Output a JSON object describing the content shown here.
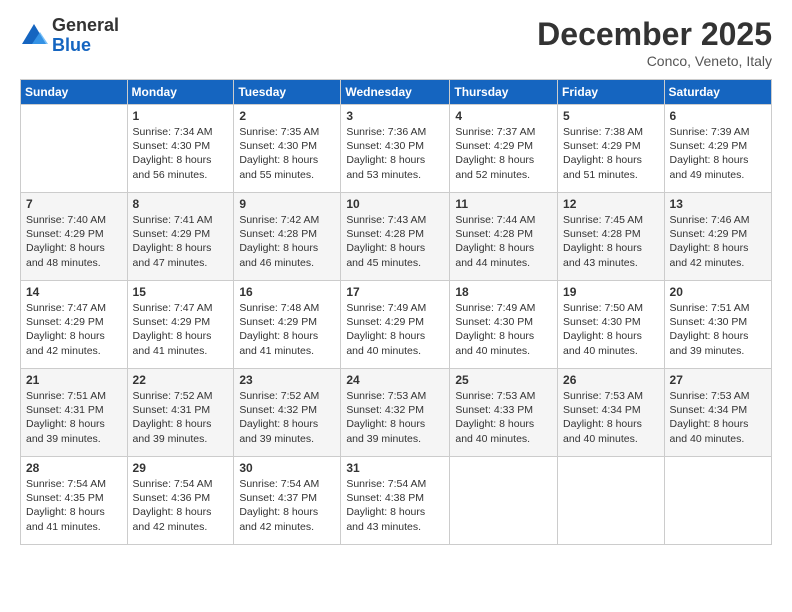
{
  "header": {
    "logo_line1": "General",
    "logo_line2": "Blue",
    "month": "December 2025",
    "location": "Conco, Veneto, Italy"
  },
  "days_of_week": [
    "Sunday",
    "Monday",
    "Tuesday",
    "Wednesday",
    "Thursday",
    "Friday",
    "Saturday"
  ],
  "weeks": [
    [
      {
        "day": "",
        "info": ""
      },
      {
        "day": "1",
        "info": "Sunrise: 7:34 AM\nSunset: 4:30 PM\nDaylight: 8 hours\nand 56 minutes."
      },
      {
        "day": "2",
        "info": "Sunrise: 7:35 AM\nSunset: 4:30 PM\nDaylight: 8 hours\nand 55 minutes."
      },
      {
        "day": "3",
        "info": "Sunrise: 7:36 AM\nSunset: 4:30 PM\nDaylight: 8 hours\nand 53 minutes."
      },
      {
        "day": "4",
        "info": "Sunrise: 7:37 AM\nSunset: 4:29 PM\nDaylight: 8 hours\nand 52 minutes."
      },
      {
        "day": "5",
        "info": "Sunrise: 7:38 AM\nSunset: 4:29 PM\nDaylight: 8 hours\nand 51 minutes."
      },
      {
        "day": "6",
        "info": "Sunrise: 7:39 AM\nSunset: 4:29 PM\nDaylight: 8 hours\nand 49 minutes."
      }
    ],
    [
      {
        "day": "7",
        "info": "Sunrise: 7:40 AM\nSunset: 4:29 PM\nDaylight: 8 hours\nand 48 minutes."
      },
      {
        "day": "8",
        "info": "Sunrise: 7:41 AM\nSunset: 4:29 PM\nDaylight: 8 hours\nand 47 minutes."
      },
      {
        "day": "9",
        "info": "Sunrise: 7:42 AM\nSunset: 4:28 PM\nDaylight: 8 hours\nand 46 minutes."
      },
      {
        "day": "10",
        "info": "Sunrise: 7:43 AM\nSunset: 4:28 PM\nDaylight: 8 hours\nand 45 minutes."
      },
      {
        "day": "11",
        "info": "Sunrise: 7:44 AM\nSunset: 4:28 PM\nDaylight: 8 hours\nand 44 minutes."
      },
      {
        "day": "12",
        "info": "Sunrise: 7:45 AM\nSunset: 4:28 PM\nDaylight: 8 hours\nand 43 minutes."
      },
      {
        "day": "13",
        "info": "Sunrise: 7:46 AM\nSunset: 4:29 PM\nDaylight: 8 hours\nand 42 minutes."
      }
    ],
    [
      {
        "day": "14",
        "info": "Sunrise: 7:47 AM\nSunset: 4:29 PM\nDaylight: 8 hours\nand 42 minutes."
      },
      {
        "day": "15",
        "info": "Sunrise: 7:47 AM\nSunset: 4:29 PM\nDaylight: 8 hours\nand 41 minutes."
      },
      {
        "day": "16",
        "info": "Sunrise: 7:48 AM\nSunset: 4:29 PM\nDaylight: 8 hours\nand 41 minutes."
      },
      {
        "day": "17",
        "info": "Sunrise: 7:49 AM\nSunset: 4:29 PM\nDaylight: 8 hours\nand 40 minutes."
      },
      {
        "day": "18",
        "info": "Sunrise: 7:49 AM\nSunset: 4:30 PM\nDaylight: 8 hours\nand 40 minutes."
      },
      {
        "day": "19",
        "info": "Sunrise: 7:50 AM\nSunset: 4:30 PM\nDaylight: 8 hours\nand 40 minutes."
      },
      {
        "day": "20",
        "info": "Sunrise: 7:51 AM\nSunset: 4:30 PM\nDaylight: 8 hours\nand 39 minutes."
      }
    ],
    [
      {
        "day": "21",
        "info": "Sunrise: 7:51 AM\nSunset: 4:31 PM\nDaylight: 8 hours\nand 39 minutes."
      },
      {
        "day": "22",
        "info": "Sunrise: 7:52 AM\nSunset: 4:31 PM\nDaylight: 8 hours\nand 39 minutes."
      },
      {
        "day": "23",
        "info": "Sunrise: 7:52 AM\nSunset: 4:32 PM\nDaylight: 8 hours\nand 39 minutes."
      },
      {
        "day": "24",
        "info": "Sunrise: 7:53 AM\nSunset: 4:32 PM\nDaylight: 8 hours\nand 39 minutes."
      },
      {
        "day": "25",
        "info": "Sunrise: 7:53 AM\nSunset: 4:33 PM\nDaylight: 8 hours\nand 40 minutes."
      },
      {
        "day": "26",
        "info": "Sunrise: 7:53 AM\nSunset: 4:34 PM\nDaylight: 8 hours\nand 40 minutes."
      },
      {
        "day": "27",
        "info": "Sunrise: 7:53 AM\nSunset: 4:34 PM\nDaylight: 8 hours\nand 40 minutes."
      }
    ],
    [
      {
        "day": "28",
        "info": "Sunrise: 7:54 AM\nSunset: 4:35 PM\nDaylight: 8 hours\nand 41 minutes."
      },
      {
        "day": "29",
        "info": "Sunrise: 7:54 AM\nSunset: 4:36 PM\nDaylight: 8 hours\nand 42 minutes."
      },
      {
        "day": "30",
        "info": "Sunrise: 7:54 AM\nSunset: 4:37 PM\nDaylight: 8 hours\nand 42 minutes."
      },
      {
        "day": "31",
        "info": "Sunrise: 7:54 AM\nSunset: 4:38 PM\nDaylight: 8 hours\nand 43 minutes."
      },
      {
        "day": "",
        "info": ""
      },
      {
        "day": "",
        "info": ""
      },
      {
        "day": "",
        "info": ""
      }
    ]
  ]
}
